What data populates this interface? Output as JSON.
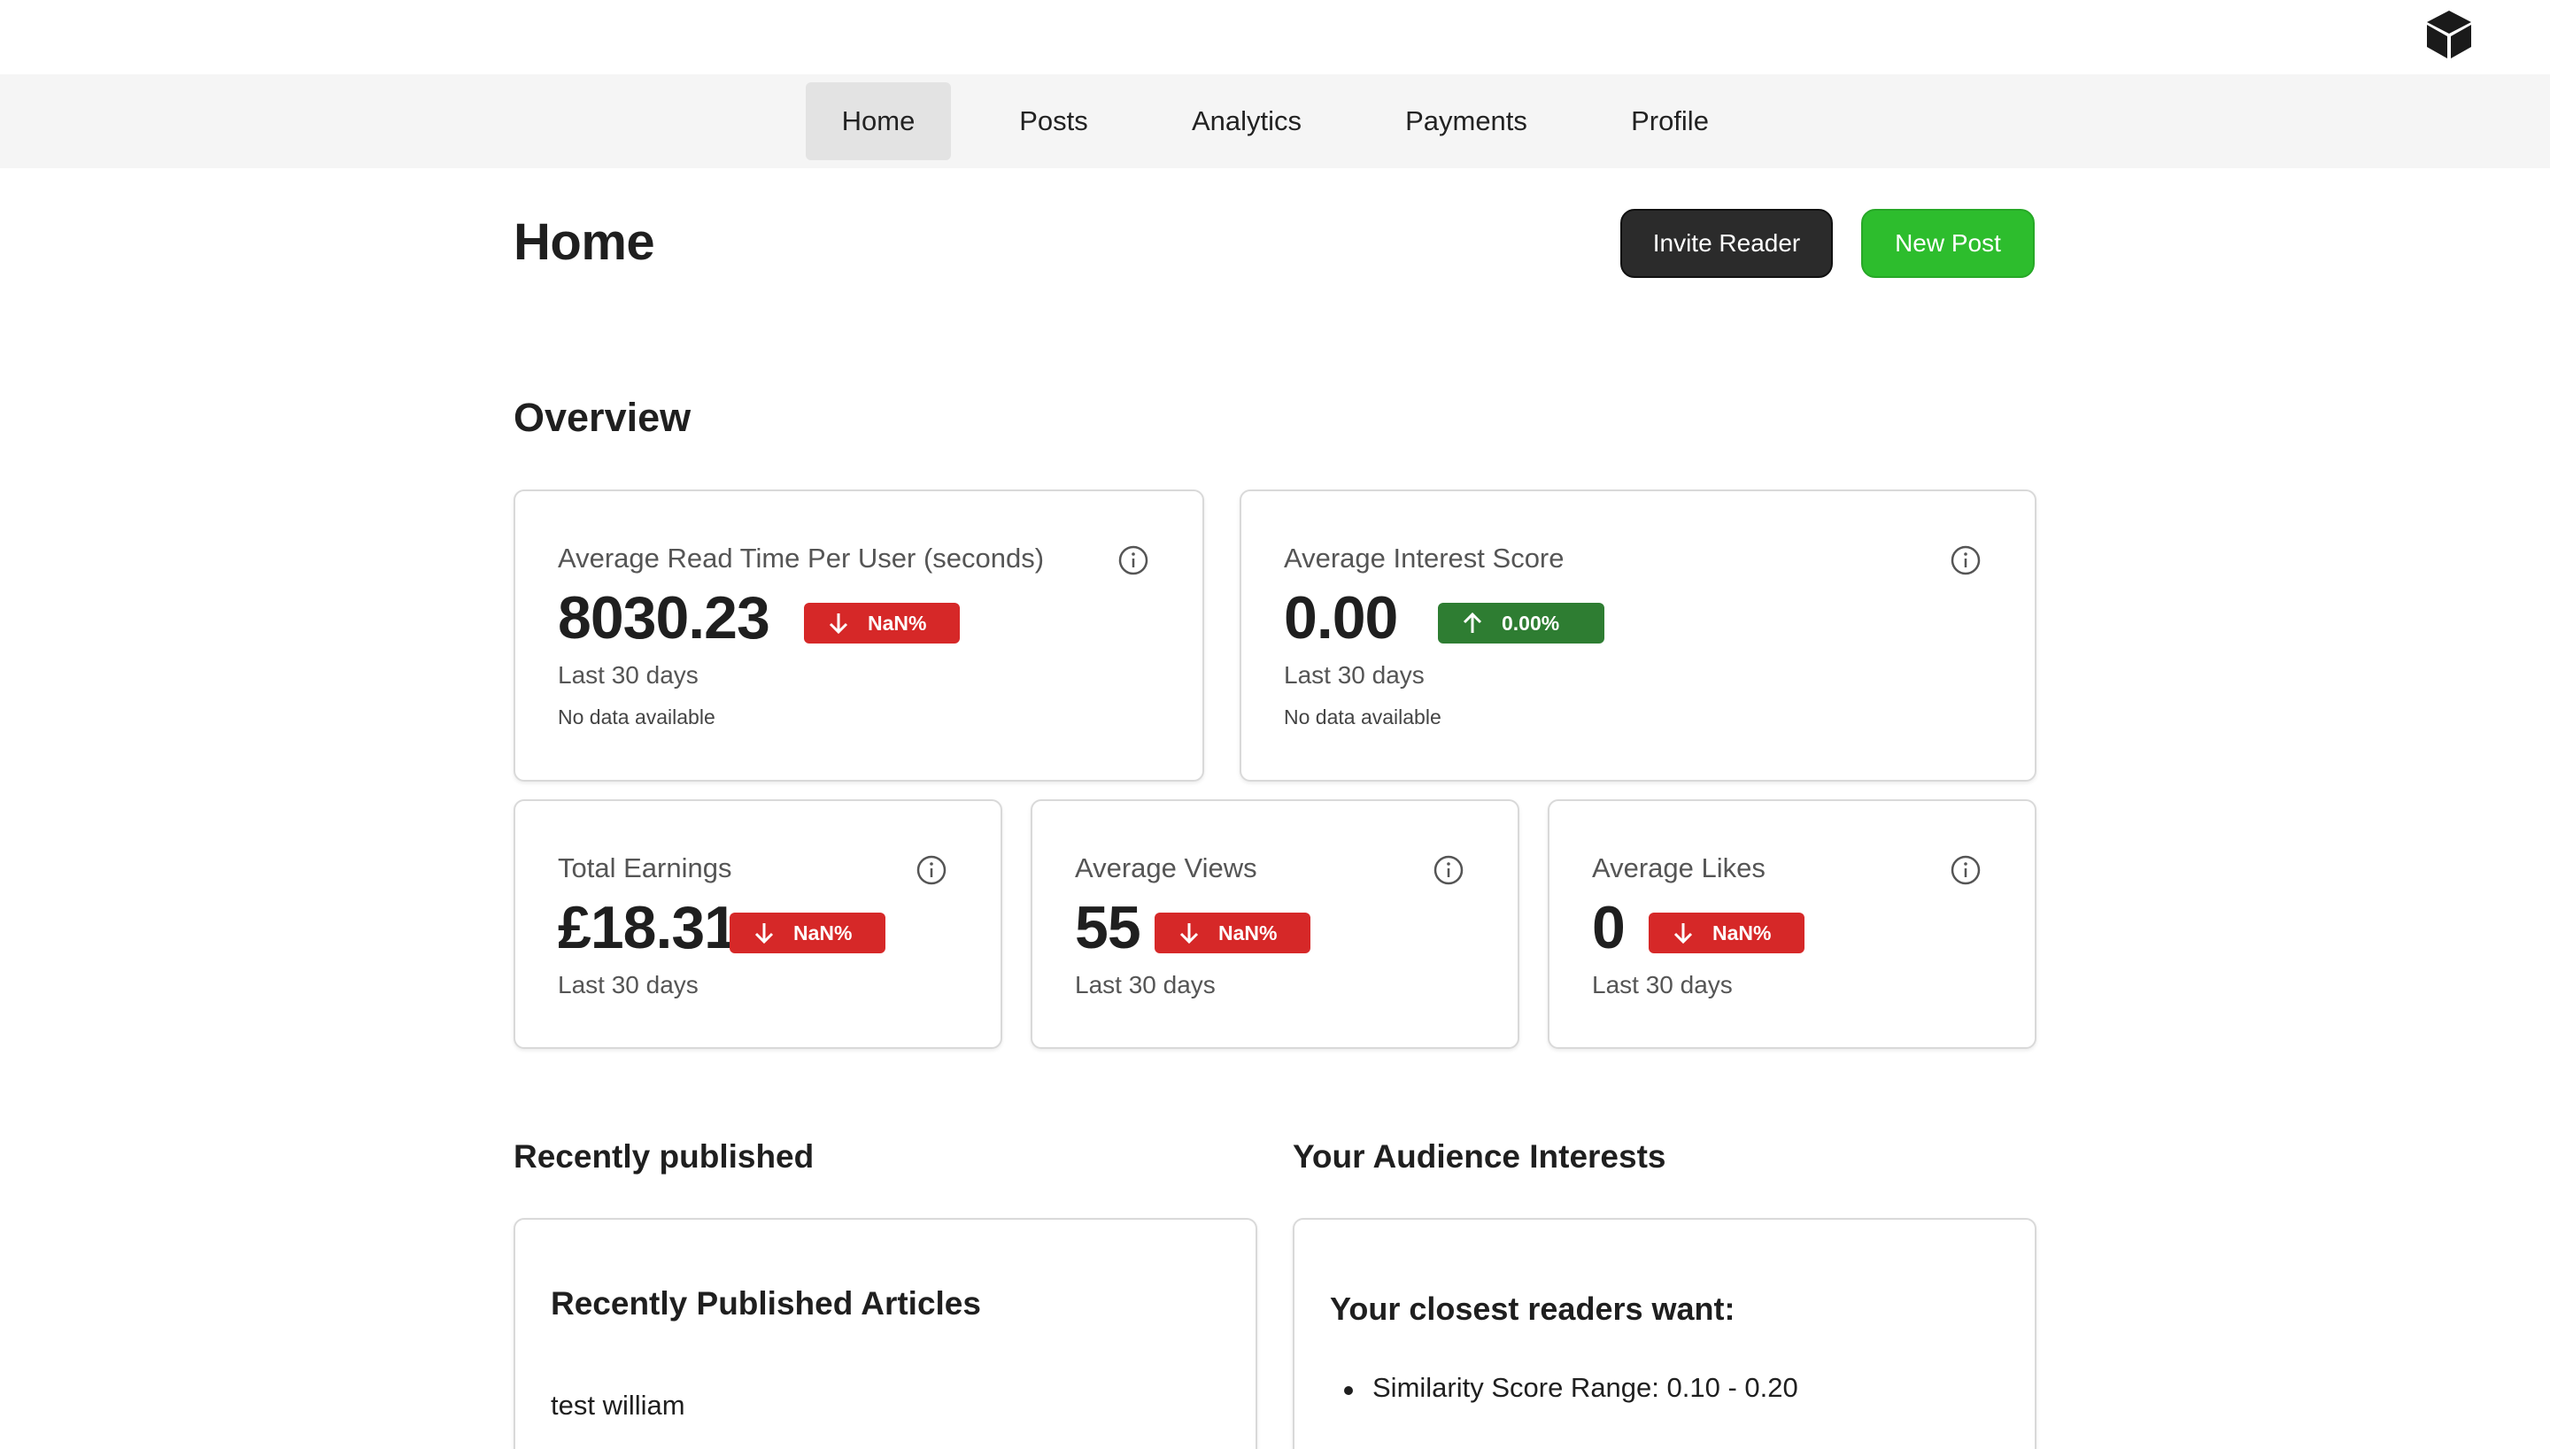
{
  "nav": {
    "items": [
      {
        "label": "Home",
        "active": true
      },
      {
        "label": "Posts",
        "active": false
      },
      {
        "label": "Analytics",
        "active": false
      },
      {
        "label": "Payments",
        "active": false
      },
      {
        "label": "Profile",
        "active": false
      }
    ]
  },
  "header": {
    "title": "Home",
    "invite_label": "Invite Reader",
    "new_post_label": "New Post"
  },
  "overview": {
    "title": "Overview",
    "cards": [
      {
        "label": "Average Read Time Per User (seconds)",
        "value": "8030.23",
        "change": "NaN%",
        "direction": "down",
        "period": "Last 30 days",
        "note": "No data available"
      },
      {
        "label": "Average Interest Score",
        "value": "0.00",
        "change": "0.00%",
        "direction": "up",
        "period": "Last 30 days",
        "note": "No data available"
      },
      {
        "label": "Total Earnings",
        "value": "£18.31",
        "change": "NaN%",
        "direction": "down",
        "period": "Last 30 days"
      },
      {
        "label": "Average Views",
        "value": "55",
        "change": "NaN%",
        "direction": "down",
        "period": "Last 30 days"
      },
      {
        "label": "Average Likes",
        "value": "0",
        "change": "NaN%",
        "direction": "down",
        "period": "Last 30 days"
      }
    ]
  },
  "recent": {
    "section_title": "Recently published",
    "card_title": "Recently Published Articles",
    "articles": [
      "test william"
    ]
  },
  "audience": {
    "section_title": "Your Audience Interests",
    "card_title": "Your closest readers want:",
    "items": [
      "Similarity Score Range: 0.10 - 0.20"
    ]
  },
  "colors": {
    "accent_green": "#2dbd2d",
    "badge_red": "#d62828",
    "badge_green": "#2e7d32",
    "dark_button": "#2b2b2b",
    "nav_background": "#f5f5f5",
    "nav_active": "#e3e3e3"
  },
  "icons": {
    "logo": "cube-icon",
    "info": "info-icon",
    "down": "arrow-down-icon",
    "up": "arrow-up-icon"
  }
}
